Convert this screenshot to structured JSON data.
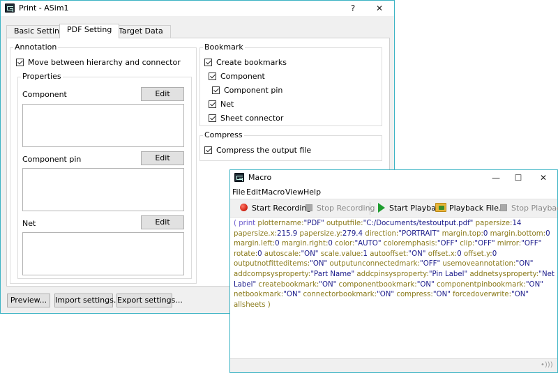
{
  "print_window": {
    "title": "Print  -  ASim1",
    "help_btn": "?",
    "close_btn": "✕",
    "tabs": [
      "Basic Setting",
      "PDF Setting",
      "Target Data"
    ],
    "annotation": {
      "title": "Annotation",
      "move_cb": "Move between hierarchy and connector",
      "properties_title": "Properties",
      "component_label": "Component",
      "component_pin_label": "Component pin",
      "net_label": "Net",
      "edit_label": "Edit"
    },
    "bookmark": {
      "title": "Bookmark",
      "create": "Create bookmarks",
      "component": "Component",
      "component_pin": "Component pin",
      "net": "Net",
      "sheet_connector": "Sheet connector"
    },
    "compress": {
      "title": "Compress",
      "compress_cb": "Compress the output file"
    },
    "buttons": {
      "preview": "Preview...",
      "import": "Import settings...",
      "export": "Export settings..."
    }
  },
  "macro_window": {
    "title": "Macro",
    "min_btn": "—",
    "max_btn": "☐",
    "close_btn": "✕",
    "menus": [
      "File",
      "Edit",
      "Macro",
      "View",
      "Help"
    ],
    "toolbar": {
      "start_recording": "Start Recording",
      "stop_recording": "Stop Recording",
      "start_playback": "Start Playback",
      "playback_file": "Playback File...",
      "stop_playback": "Stop Playback"
    },
    "script_open": "( print ",
    "params": [
      [
        "plottername:",
        "\"PDF\""
      ],
      [
        "outputfile:",
        "\"C:/Documents/testoutput.pdf\""
      ],
      [
        "papersize:",
        "14"
      ],
      [
        "papersize.x:",
        "215.9"
      ],
      [
        "papersize.y:",
        "279.4"
      ],
      [
        "direction:",
        "\"PORTRAIT\""
      ],
      [
        "margin.top:",
        "0"
      ],
      [
        "margin.bottom:",
        "0"
      ],
      [
        "margin.left:",
        "0"
      ],
      [
        "margin.right:",
        "0"
      ],
      [
        "color:",
        "\"AUTO\""
      ],
      [
        "coloremphasis:",
        "\"OFF\""
      ],
      [
        "clip:",
        "\"OFF\""
      ],
      [
        "mirror:",
        "\"OFF\""
      ],
      [
        "rotate:",
        "0"
      ],
      [
        "autoscale:",
        "\"ON\""
      ],
      [
        "scale.value:",
        "1"
      ],
      [
        "autooffset:",
        "\"ON\""
      ],
      [
        "offset.x:",
        "0"
      ],
      [
        "offset.y:",
        "0"
      ],
      [
        "outputnotfitteditems:",
        "\"ON\""
      ],
      [
        "outputunconnectedmark:",
        "\"OFF\""
      ],
      [
        "usemoveannotation:",
        "\"ON\""
      ],
      [
        "addcompsysproperty:",
        "\"Part Name\""
      ],
      [
        "addcpinsysproperty:",
        "\"Pin Label\""
      ],
      [
        "addnetsysproperty:",
        "\"Net Label\""
      ],
      [
        "createbookmark:",
        "\"ON\""
      ],
      [
        "componentbookmark:",
        "\"ON\""
      ],
      [
        "componentpinbookmark:",
        "\"ON\""
      ],
      [
        "netbookmark:",
        "\"ON\""
      ],
      [
        "connectorbookmark:",
        "\"ON\""
      ],
      [
        "compress:",
        "\"ON\""
      ],
      [
        "forcedoverwrite:",
        "\"ON\""
      ]
    ],
    "script_tail": " allsheets )",
    "status_icon": "•)))"
  },
  "colors": {
    "accent": "#3bb3c4",
    "keyword": "#8a7a1a",
    "value": "#1a1a8a",
    "record": "#d62a1a",
    "play": "#1e9d2f"
  }
}
